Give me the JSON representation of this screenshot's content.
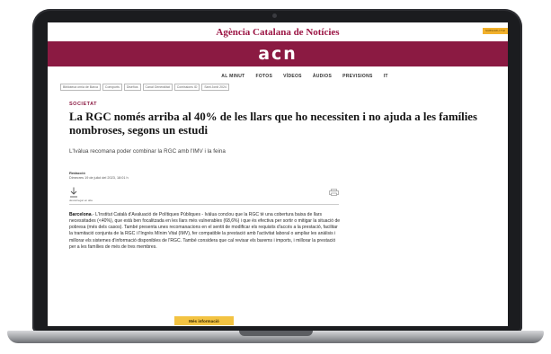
{
  "site": {
    "agency_name": "Agència Catalana de Notícies",
    "top_badge": "SUBSCRIU-T'HI",
    "brand": "acn"
  },
  "nav": {
    "items": [
      "AL MINUT",
      "FOTOS",
      "VÍDEOS",
      "ÀUDIOS",
      "PREVISIONS",
      "IT"
    ]
  },
  "breadcrumbs": [
    "Bibliotecà ornia de Barca",
    "Coexports",
    "Diseños",
    "Canal Generalitat",
    "Comissions ID",
    "Sant Jordi 2024"
  ],
  "article": {
    "section": "SOCIETAT",
    "headline": "La RGC només arriba al 40% de les llars que ho necessiten i no ajuda a les famílies nombroses, segons un estudi",
    "subtitle": "L'Ivàlua recomana poder combinar la RGC amb l'IMV i la feina",
    "byline_label": "Redacció",
    "byline_date": "Dimecres 19 de juliol del 2023, 18:01 h",
    "download_caption": "descarregar en alta",
    "body_lead": "Barcelona",
    "body": ".- L'Institut Català d'Avaluació de Polítiques Públiques - Ivàlua conclou que la RGC té una cobertura baixa de llars necessitades (<40%), que està ben focalitzada en les llars més vulnerables (68,6%) i que és efectiva per sortir o mitigar la situació de pobresa (més dels casos). També presenta unes recomanacions en el sentit de modificar els requisits d'accés a la prestació, facilitar la tramitació conjunta de la RGC i l'Ingrés Mínim Vital (IMV), fer compatible la prestació amb l'activitat laboral o ampliar les anàlisis i millorar els sistemes d'informació disponibles de l'RGC. També considera que cal revisar els barems i imports, i millorar la prestació per a les famílies de més de tres membres.",
    "more_button": "Més informació"
  },
  "colors": {
    "brand": "#8b1a42",
    "accent": "#f3c342",
    "frame": "#1b1c1f"
  },
  "icons": [
    "download-icon",
    "print-icon"
  ]
}
